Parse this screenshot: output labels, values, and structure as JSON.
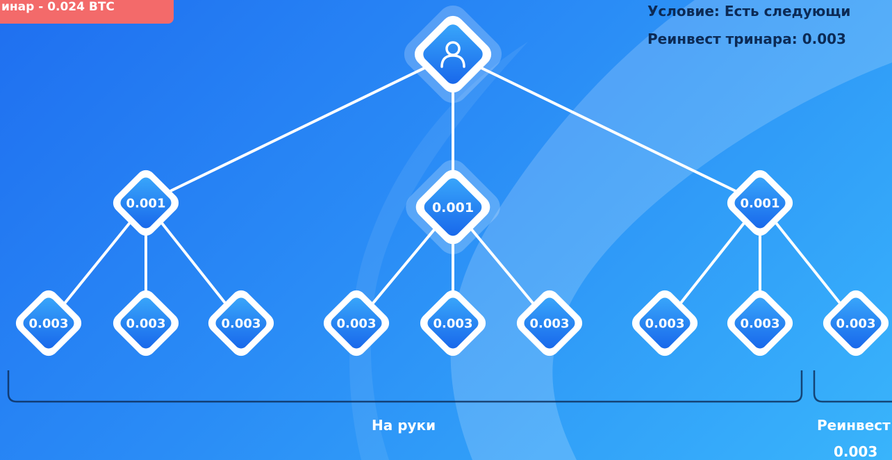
{
  "badge": {
    "text": "инар - 0.024 BTC"
  },
  "condition": {
    "line1": "Условие: Есть следующи",
    "line2": "Реинвест тринара: 0.003"
  },
  "tree": {
    "root": {
      "icon": "user-icon"
    },
    "level1": [
      "0.001",
      "0.001",
      "0.001"
    ],
    "level2": [
      "0.003",
      "0.003",
      "0.003",
      "0.003",
      "0.003",
      "0.003",
      "0.003",
      "0.003",
      "0.003"
    ]
  },
  "groups": {
    "on_hands": "На руки",
    "reinvest": "Реинвест",
    "reinvest_value": "0.003"
  },
  "colors": {
    "background_start": "#1f6ff0",
    "background_end": "#39b4fb",
    "badge": "#f36a6a",
    "node_outline": "#ffffff",
    "node_fill": "#1a78f0",
    "condition_text": "#0c2a55"
  }
}
